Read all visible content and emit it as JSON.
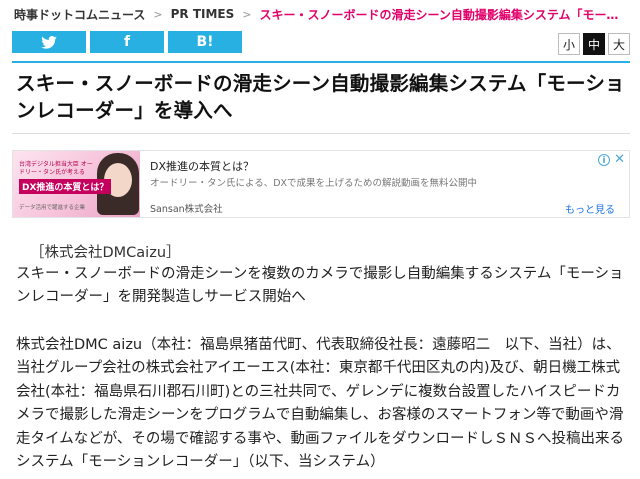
{
  "breadcrumb": {
    "site": "時事ドットコムニュース",
    "separator": ">",
    "source": "PR TIMES",
    "current": "スキー・スノーボードの滑走シーン自動撮影編集システム「モーシ..."
  },
  "share": {
    "twitter_icon": "twitter-bird-icon",
    "twitter_glyph": "🐦",
    "facebook_glyph": "f",
    "hatena_glyph": "B!"
  },
  "font_size": {
    "small": "小",
    "medium": "中",
    "large": "大",
    "active": "medium"
  },
  "article": {
    "headline": "スキー・スノーボードの滑走シーン自動撮影編集システム「モーションレコーダー」を導入へ",
    "company_tag": "［株式会社DMCaizu］",
    "lead": "スキー・スノーボードの滑走シーンを複数のカメラで撮影し自動編集するシステム「モーションレコーダー」を開発製造しサービス開始へ",
    "body": "株式会社DMC aizu（本社：福島県猪苗代町、代表取締役社長：遠藤昭二　以下、当社）は、当社グループ会社の株式会社アイエーエス(本社：東京都千代田区丸の内)及び、朝日機工株式会社(本社：福島県石川郡石川町)との三社共同で、ゲレンデに複数台設置したハイスピードカメラで撮影した滑走シーンをプログラムで自動編集し、お客様のスマートフォン等で動画や滑走タイムなどが、その場で確認する事や、動画ファイルをダウンロードしＳＮＳへ投稿出来るシステム「モーションレコーダー」（以下、当システム）"
  },
  "ad": {
    "title": "DX推進の本質とは？",
    "description": "オードリー・タン氏による、DXで成果を上げるための解説動画を無料公開中",
    "sponsor": "Sansan株式会社",
    "more_link": "もっと見る",
    "thumb_text_1": "台湾デジタル担当大臣 オードリー・タン氏が考える",
    "thumb_text_2": "DX推進の本質とは？",
    "thumb_text_3": "データ活用で躍進する企業",
    "colors": {
      "link": "#1a73e8",
      "accent": "#c4005c"
    }
  },
  "colors": {
    "brand": "#27b0e1",
    "breadcrumb_current": "#e2006a"
  }
}
